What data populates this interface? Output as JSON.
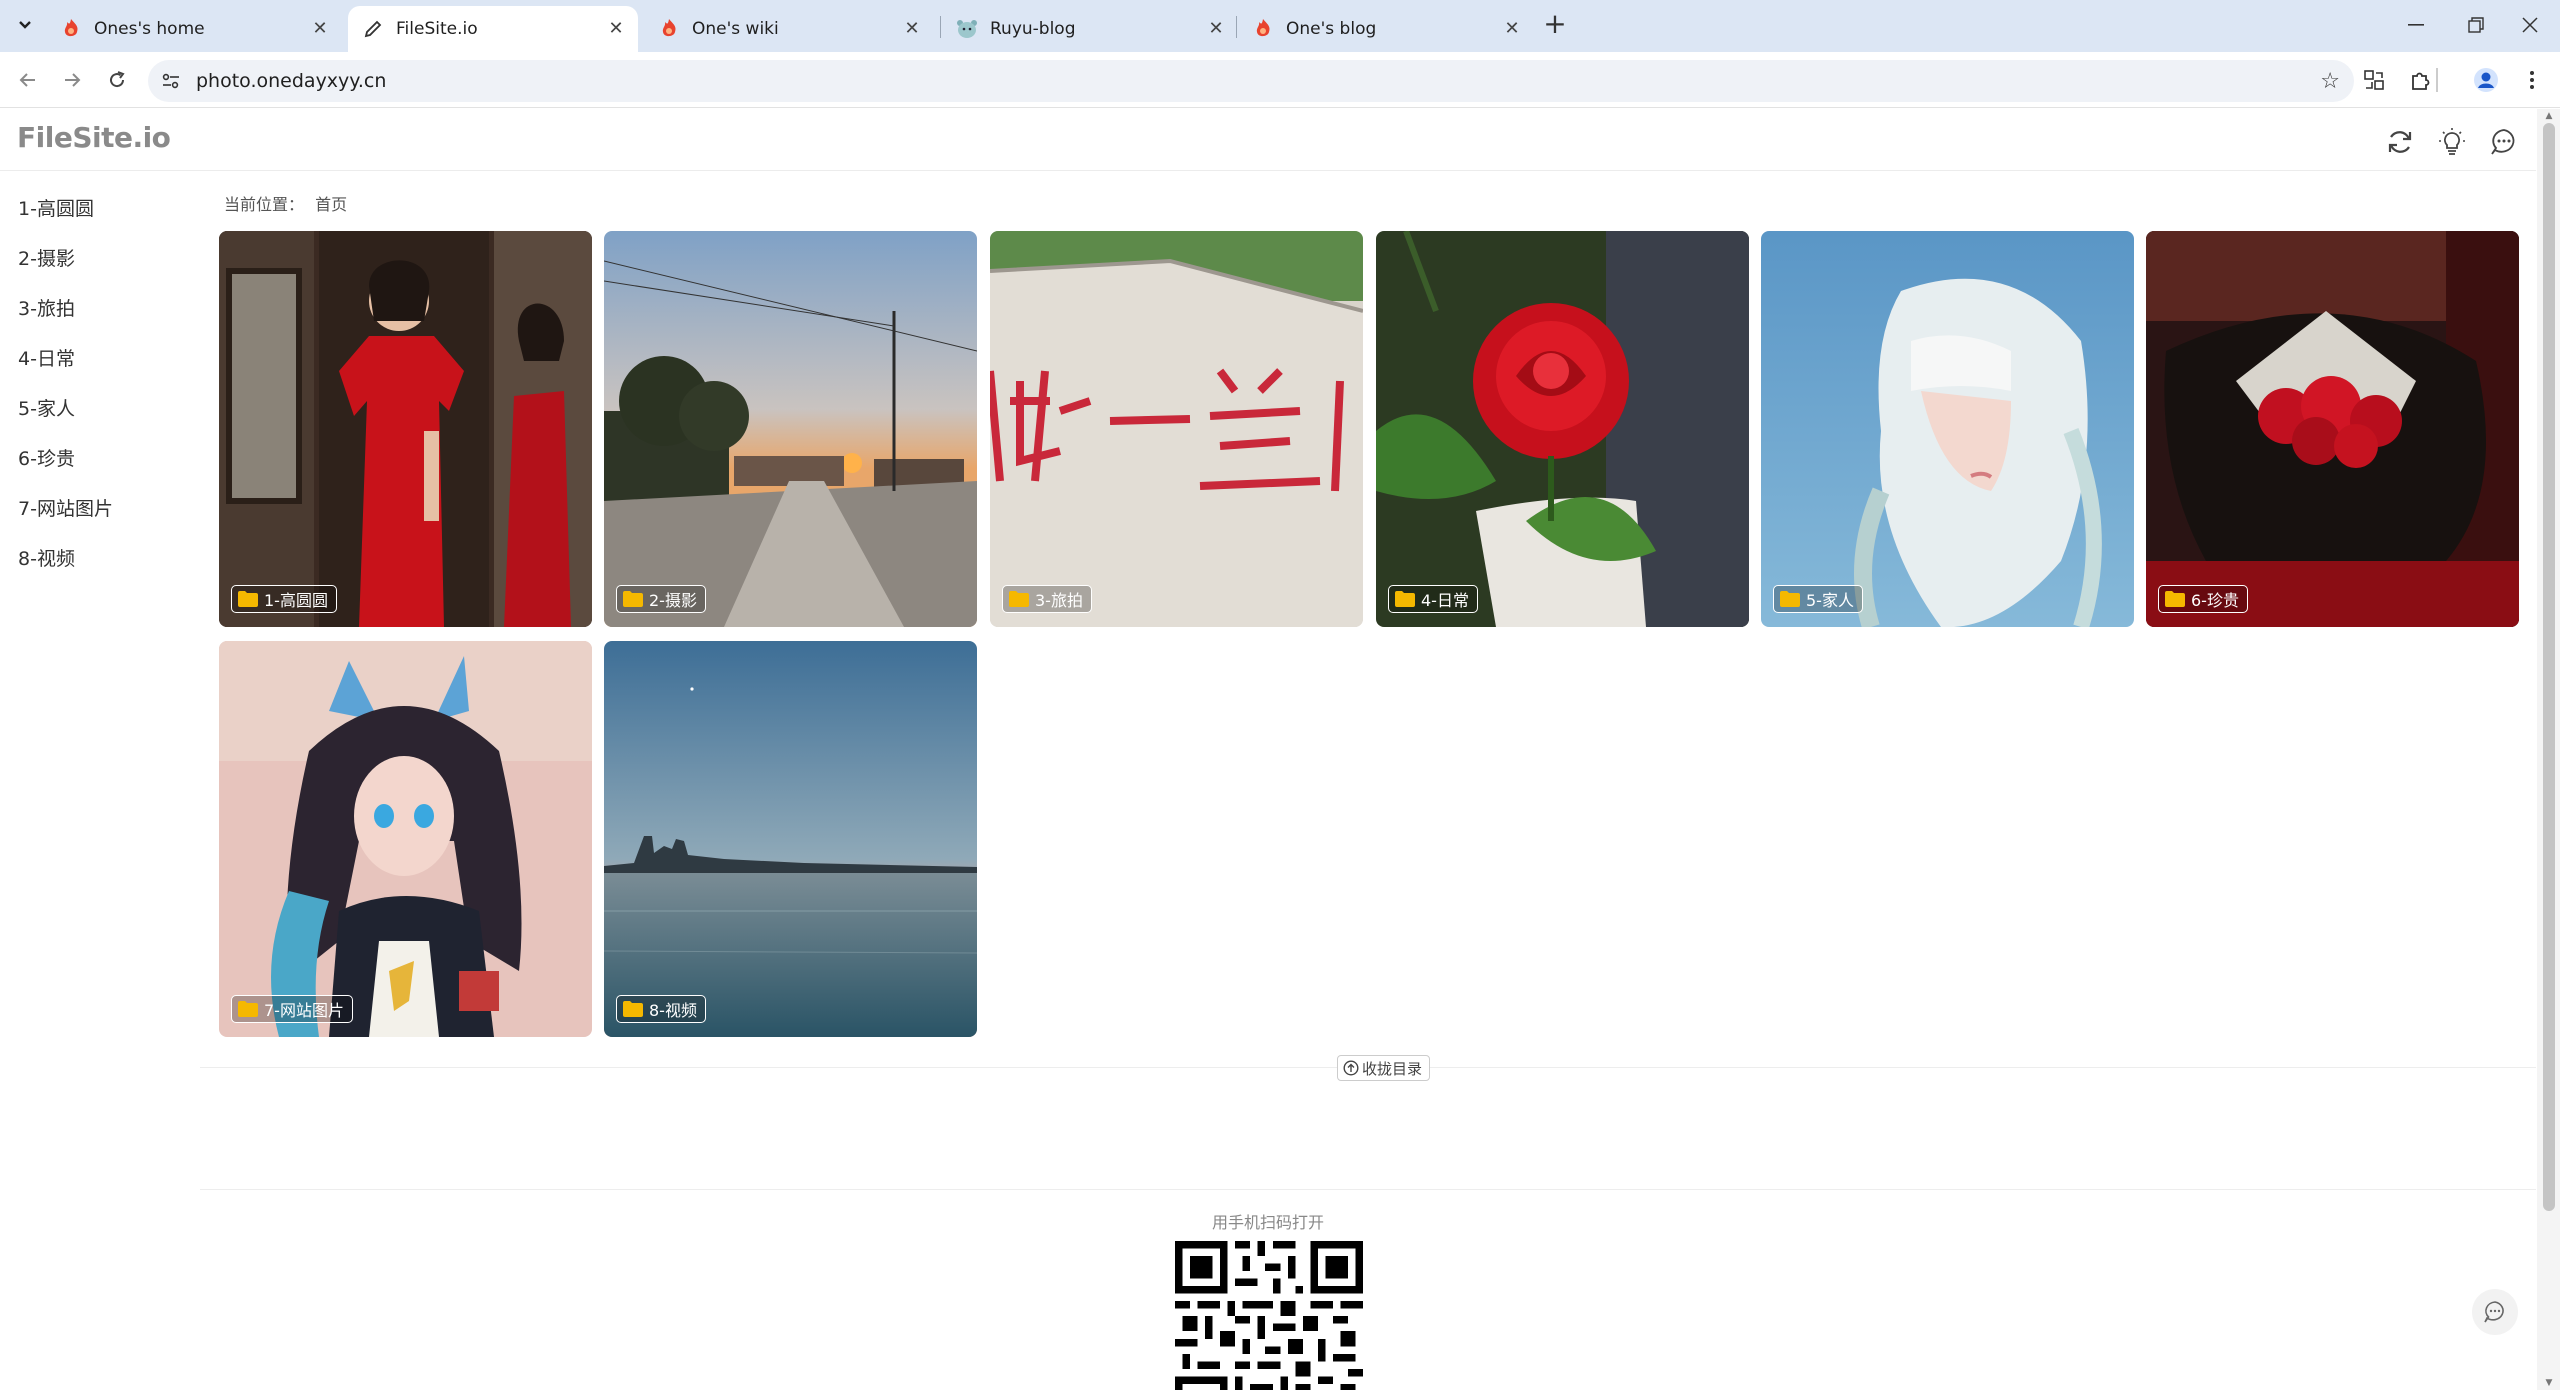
{
  "browser": {
    "tabs": [
      {
        "title": "Ones's home"
      },
      {
        "title": "FileSite.io"
      },
      {
        "title": "One's wiki"
      },
      {
        "title": "Ruyu-blog"
      },
      {
        "title": "One's blog"
      }
    ],
    "url": "photo.onedayxyy.cn"
  },
  "site": {
    "logo": "FileSite.io"
  },
  "sidebar": {
    "items": [
      {
        "label": "1-高圆圆"
      },
      {
        "label": "2-摄影"
      },
      {
        "label": "3-旅拍"
      },
      {
        "label": "4-日常"
      },
      {
        "label": "5-家人"
      },
      {
        "label": "6-珍贵"
      },
      {
        "label": "7-网站图片"
      },
      {
        "label": "8-视频"
      }
    ]
  },
  "breadcrumb": {
    "prefix": "当前位置：",
    "current": "首页"
  },
  "folders": [
    {
      "label": "1-高圆圆"
    },
    {
      "label": "2-摄影"
    },
    {
      "label": "3-旅拍"
    },
    {
      "label": "4-日常"
    },
    {
      "label": "5-家人"
    },
    {
      "label": "6-珍贵"
    },
    {
      "label": "7-网站图片"
    },
    {
      "label": "8-视频"
    }
  ],
  "collapse_label": "收拢目录",
  "qr_caption": "用手机扫码打开",
  "colors": {
    "tabstrip": "#dce6f4",
    "folder_icon": "#f5b800",
    "logo": "#8a8a8a"
  }
}
